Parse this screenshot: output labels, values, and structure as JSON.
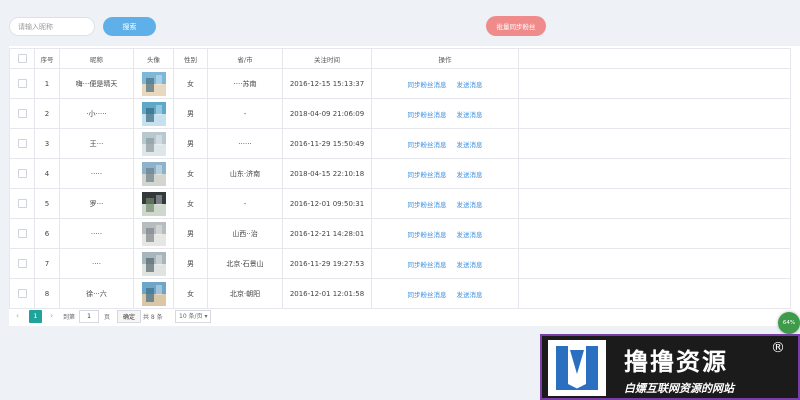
{
  "toolbar": {
    "search_placeholder": "请输入昵称",
    "search_button": "搜索",
    "batch_button": "批量同步粉丝"
  },
  "table": {
    "headers": [
      "序号",
      "昵称",
      "头像",
      "性别",
      "省/市",
      "关注时间",
      "操作"
    ],
    "rows": [
      {
        "index": "1",
        "nickname": "嗨···便是晴天",
        "gender": "女",
        "region": "····苏南",
        "follow_time": "2016-12-15 15:13:37"
      },
      {
        "index": "2",
        "nickname": "·小·····",
        "gender": "男",
        "region": "-",
        "follow_time": "2018-04-09 21:06:09"
      },
      {
        "index": "3",
        "nickname": "王···",
        "gender": "男",
        "region": "······",
        "follow_time": "2016-11-29 15:50:49"
      },
      {
        "index": "4",
        "nickname": "·····",
        "gender": "女",
        "region": "山东·济南",
        "follow_time": "2018-04-15 22:10:18"
      },
      {
        "index": "5",
        "nickname": "罗···",
        "gender": "女",
        "region": "-",
        "follow_time": "2016-12-01 09:50:31"
      },
      {
        "index": "6",
        "nickname": "·····",
        "gender": "男",
        "region": "山西··治",
        "follow_time": "2016-12-21 14:28:01"
      },
      {
        "index": "7",
        "nickname": "····",
        "gender": "男",
        "region": "北京·石景山",
        "follow_time": "2016-11-29 19:27:53"
      },
      {
        "index": "8",
        "nickname": "徐···六",
        "gender": "女",
        "region": "北京·朝阳",
        "follow_time": "2016-12-01 12:01:58"
      }
    ],
    "actions": {
      "sync": "同步粉丝消息",
      "send": "发送消息"
    }
  },
  "pager": {
    "prev": "‹",
    "current": "1",
    "next": "›",
    "goto_label": "到第",
    "goto_value": "1",
    "page_label": "页",
    "confirm": "确定",
    "total": "共 8 条",
    "page_size": "10 条/页 ▾"
  },
  "float_badge": "64%",
  "watermark": {
    "title": "撸撸资源",
    "reg": "®",
    "subtitle": "白嫖互联网资源的网站"
  },
  "colors": {
    "primary": "#5fb0e8",
    "danger": "#f08b8b",
    "pager_active": "#1fa39a",
    "link": "#3a8fe0"
  },
  "avatar_palettes": [
    [
      "#7fb7d8",
      "#e8d8c0",
      "#4a6d7c"
    ],
    [
      "#5fa8c8",
      "#c6e0ee",
      "#35687f"
    ],
    [
      "#b9c7cf",
      "#dfe6ea",
      "#8a989f"
    ],
    [
      "#8fb2cc",
      "#d3d6cf",
      "#6c7d86"
    ],
    [
      "#343a3c",
      "#cfd8cc",
      "#6f8a6a"
    ],
    [
      "#b7bcbe",
      "#e6e6e4",
      "#7e858a"
    ],
    [
      "#a7b6bd",
      "#e1e3e0",
      "#56666d"
    ],
    [
      "#6fa5c9",
      "#d9c7a5",
      "#3d6f8a"
    ]
  ]
}
